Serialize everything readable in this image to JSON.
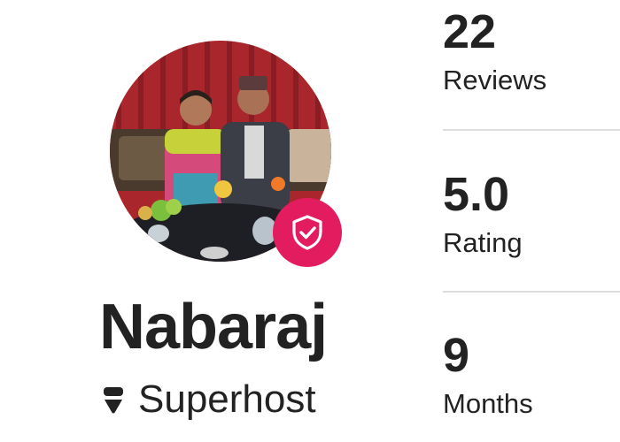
{
  "host": {
    "name": "Nabaraj",
    "superhost_label": "Superhost"
  },
  "icons": {
    "verified_badge": "shield-check-icon",
    "superhost_badge": "superhost-icon"
  },
  "colors": {
    "verified_badge": "#e31c5f",
    "text": "#222222",
    "divider": "#dddddd"
  },
  "stats": [
    {
      "value": "22",
      "label": "Reviews"
    },
    {
      "value": "5.0",
      "label": "Rating"
    },
    {
      "value": "9",
      "label": "Months"
    }
  ]
}
